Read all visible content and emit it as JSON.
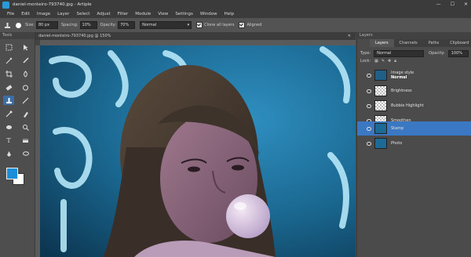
{
  "window": {
    "title": "daniel-monteiro-793740.jpg - Artiple",
    "controls": [
      "—",
      "☐",
      "✕"
    ]
  },
  "menu": [
    "File",
    "Edit",
    "Image",
    "Layer",
    "Select",
    "Adjust",
    "Filter",
    "Module",
    "View",
    "Settings",
    "Window",
    "Help"
  ],
  "tool_options": {
    "size_label": "Size:",
    "size_value": "80 px",
    "spacing_label": "Spacing:",
    "spacing_value": "10%",
    "opacity_label": "Opacity:",
    "opacity_value": "70%",
    "blend_value": "Normal",
    "clone_all_layers_label": "Clone all layers",
    "aligned_label": "Aligned"
  },
  "tools_panel": {
    "header": "Tools"
  },
  "document": {
    "tab_title": "daniel-monteiro-793740.jpg @ 150%"
  },
  "layers_panel": {
    "header": "Layers",
    "tabs": [
      "Layers",
      "Channels",
      "Paths",
      "Clipboard"
    ],
    "type_label": "Type:",
    "blend_value": "Normal",
    "lock_label": "Lock:",
    "opacity_label": "Opacity:",
    "opacity_value": "100%",
    "layers": [
      {
        "name": "Image style",
        "sub": "Normal",
        "active": false
      },
      {
        "name": "Brightness",
        "active": false
      },
      {
        "name": "Bubble Highlight",
        "active": false
      },
      {
        "name": "Smoothen",
        "active": false
      },
      {
        "name": "Stamp",
        "active": true
      },
      {
        "name": "Photo",
        "active": false
      }
    ]
  },
  "colors": {
    "accent": "#3b78c4",
    "foreground": "#1a8ed8",
    "background": "#ffffff"
  }
}
